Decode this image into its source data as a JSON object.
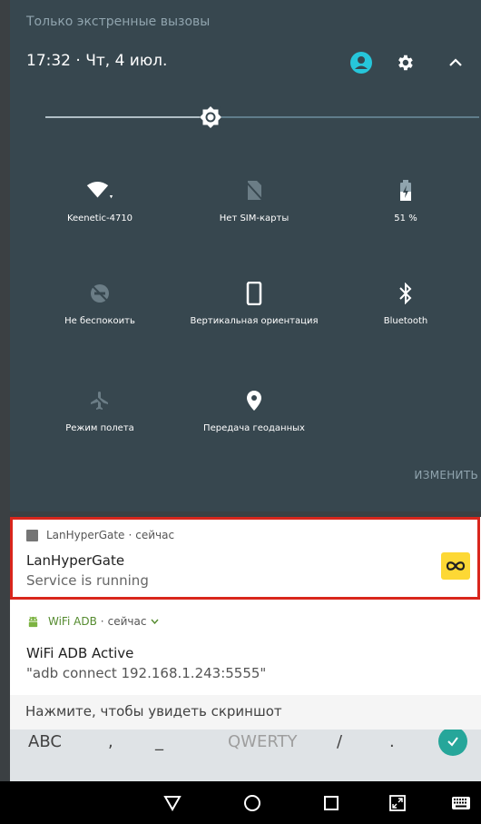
{
  "status": {
    "emergency_only": "Только экстренные вызовы"
  },
  "header": {
    "clock": "17:32 · Чт, 4 июл."
  },
  "brightness": {
    "level": 0.38
  },
  "tiles": [
    {
      "label": "Keenetic-4710",
      "icon": "wifi-icon"
    },
    {
      "label": "Нет SIM-карты",
      "icon": "no-sim-icon"
    },
    {
      "label": "51 %",
      "icon": "battery-icon"
    },
    {
      "label": "Не беспокоить",
      "icon": "do-not-disturb-icon"
    },
    {
      "label": "Вертикальная ориентация",
      "icon": "portrait-orientation-icon"
    },
    {
      "label": "Bluetooth",
      "icon": "bluetooth-icon"
    },
    {
      "label": "Режим полета",
      "icon": "airplane-mode-icon"
    },
    {
      "label": "Передача геоданных",
      "icon": "location-icon"
    }
  ],
  "edit_label": "ИЗМЕНИТЬ",
  "notifications": [
    {
      "app": "LanHyperGate",
      "time": "сейчас",
      "title": "LanHyperGate",
      "text": "Service is running"
    },
    {
      "app": "WiFi ADB",
      "time": "сейчас",
      "title": "WiFi ADB Active",
      "text": "\"adb connect 192.168.1.243:5555\""
    },
    {
      "text": "Нажмите, чтобы увидеть скриншот"
    }
  ],
  "keyboard": {
    "keys": [
      "ABC",
      ",",
      "_",
      "QWERTY",
      "/",
      "."
    ]
  },
  "colors": {
    "shade_bg": "#37474f",
    "accent": "#26c6da",
    "highlight": "#d9261c",
    "app_accent": "#fdd835"
  }
}
